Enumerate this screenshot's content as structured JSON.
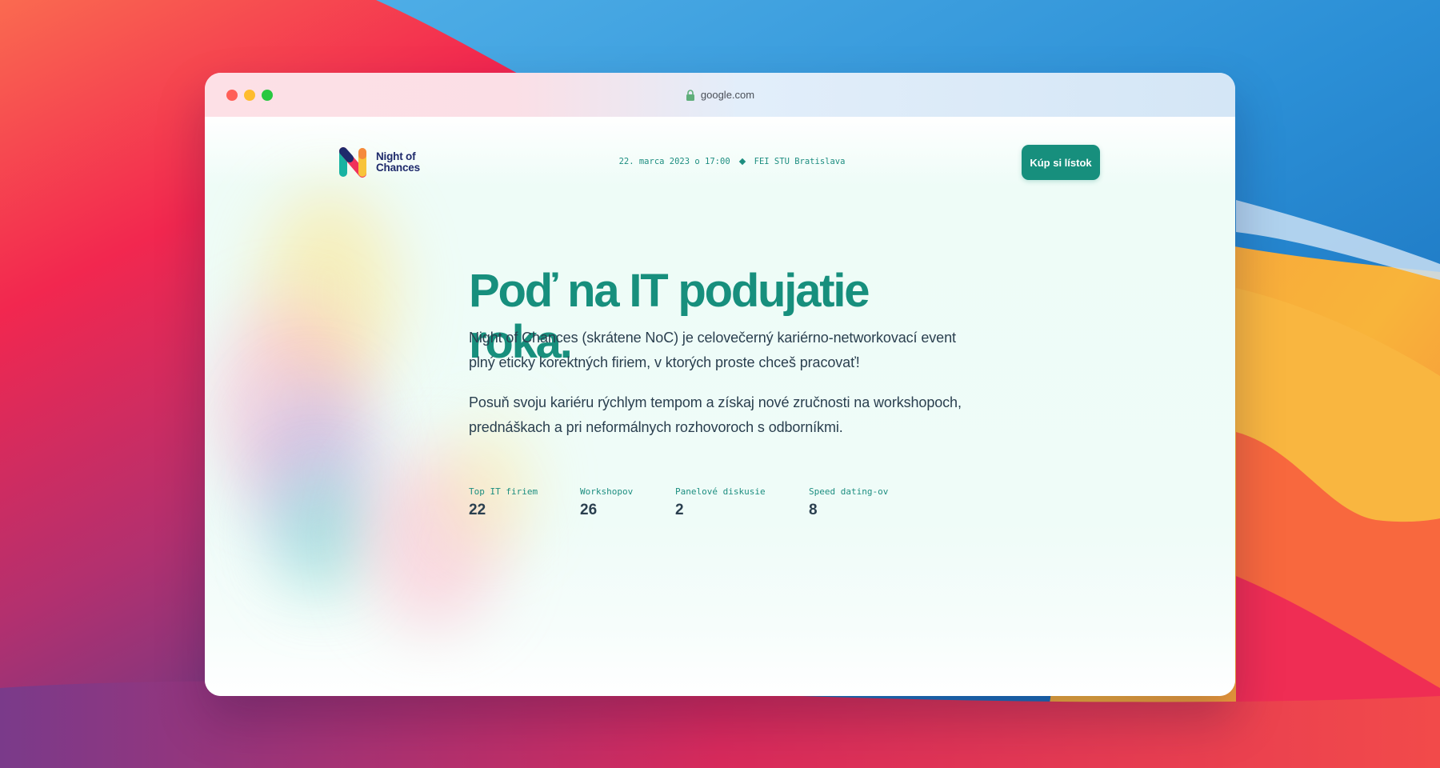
{
  "browser": {
    "url": "google.com"
  },
  "site": {
    "logo_line1": "Night of",
    "logo_line2": "Chances",
    "event_date": "22. marca 2023 o 17:00",
    "event_place": "FEI STU Bratislava",
    "cta_label": "Kúp si lístok"
  },
  "hero": {
    "title": "Poď na IT podujatie roka.",
    "paragraph1": "Night of Chances (skrátene NoC) je celovečerný kariérno-networkovací event plný eticky korektných firiem, v ktorých proste chceš pracovať!",
    "paragraph2": "Posuň svoju kariéru rýchlym tempom a získaj nové zručnosti na workshopoch, prednáškach a pri neformálnych rozhovoroch s odborníkmi."
  },
  "stats": [
    {
      "label": "Top IT firiem",
      "value": "22"
    },
    {
      "label": "Workshopov",
      "value": "26"
    },
    {
      "label": "Panelové diskusie",
      "value": "2"
    },
    {
      "label": "Speed dating-ov",
      "value": "8"
    }
  ],
  "colors": {
    "accent": "#178f7d",
    "logo_navy": "#1e2a6b",
    "text": "#2a3f4f"
  },
  "icons": {
    "lock": "lock-icon",
    "separator": "diamond-icon",
    "logo": "noc-logo-icon"
  }
}
